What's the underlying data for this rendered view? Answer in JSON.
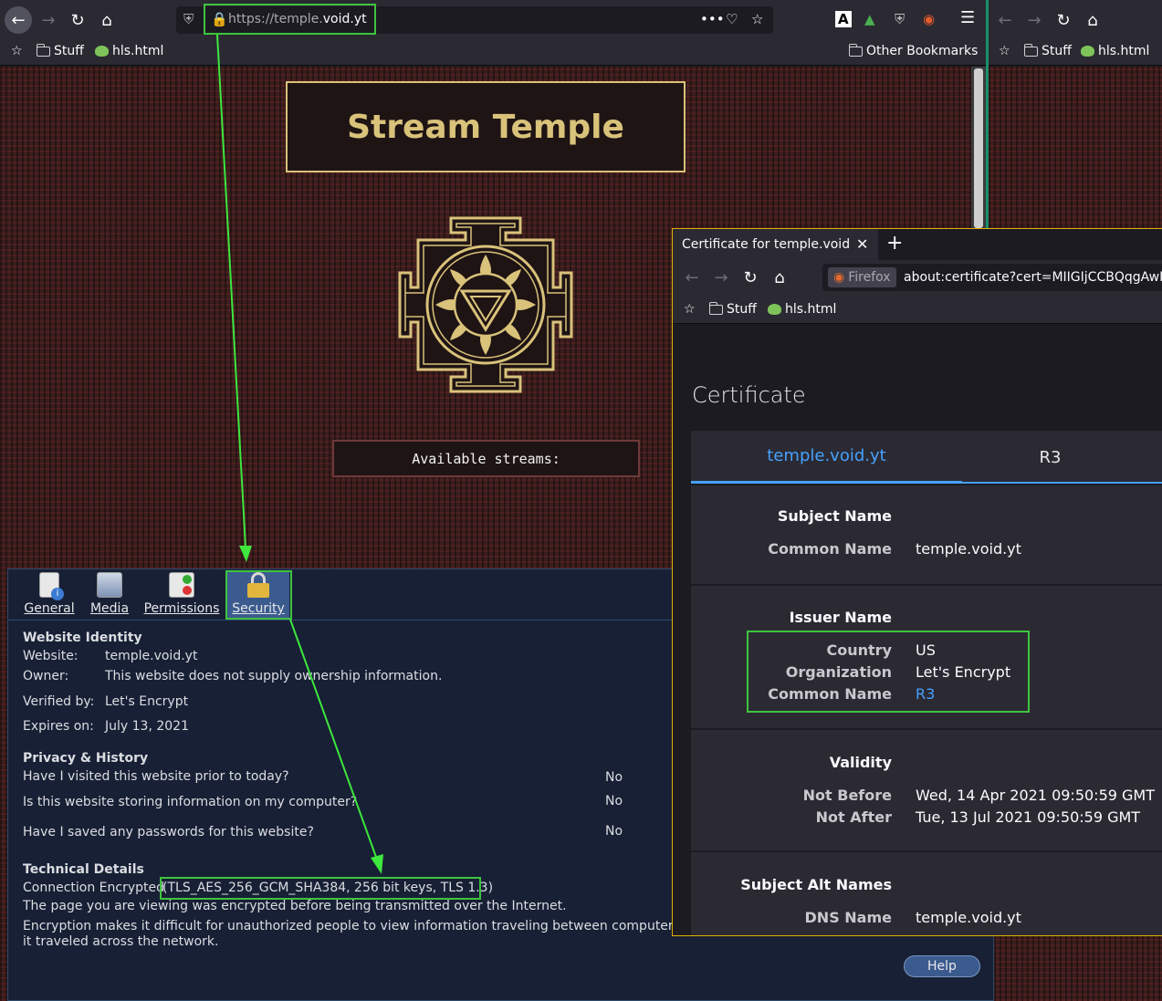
{
  "browser": {
    "url_prefix": "https://temple.",
    "url_domain": "void.yt",
    "bookmarks": {
      "stuff": "Stuff",
      "hls": "hls.html",
      "other": "Other Bookmarks"
    }
  },
  "page": {
    "title": "Stream Temple",
    "streams_label": "Available streams:"
  },
  "page_info": {
    "tabs": {
      "general": "General",
      "media": "Media",
      "permissions": "Permissions",
      "security": "Security"
    },
    "identity": {
      "heading": "Website Identity",
      "website_label": "Website:",
      "website_value": "temple.void.yt",
      "owner_label": "Owner:",
      "owner_value": "This website does not supply ownership information.",
      "verified_label": "Verified by:",
      "verified_value": "Let's Encrypt",
      "expires_label": "Expires on:",
      "expires_value": "July 13, 2021"
    },
    "privacy": {
      "heading": "Privacy & History",
      "q1": "Have I visited this website prior to today?",
      "a1": "No",
      "q2": "Is this website storing information on my computer?",
      "a2": "No",
      "q3": "Have I saved any passwords for this website?",
      "a3": "No"
    },
    "technical": {
      "heading": "Technical Details",
      "encrypted_label": "Connection Encrypted",
      "cipher": "(TLS_AES_256_GCM_SHA384, 256 bit keys, TLS 1.3)",
      "line2": "The page you are viewing was encrypted before being transmitted over the Internet.",
      "line3": "Encryption makes it difficult for unauthorized people to view information traveling between computers. It i",
      "line4": "it traveled across the network."
    },
    "help": "Help"
  },
  "cert_window": {
    "tab_title": "Certificate for temple.void.y",
    "identity_badge": "Firefox",
    "url": "about:certificate?cert=MIIGIjCCBQqgAwI",
    "bookmarks": {
      "stuff": "Stuff",
      "hls": "hls.html"
    },
    "heading": "Certificate",
    "tabs": {
      "leaf": "temple.void.yt",
      "issuer": "R3"
    },
    "subject": {
      "title": "Subject Name",
      "cn_label": "Common Name",
      "cn_value": "temple.void.yt"
    },
    "issuer": {
      "title": "Issuer Name",
      "country_label": "Country",
      "country_value": "US",
      "org_label": "Organization",
      "org_value": "Let's Encrypt",
      "cn_label": "Common Name",
      "cn_value": "R3"
    },
    "validity": {
      "title": "Validity",
      "nb_label": "Not Before",
      "nb_value": "Wed, 14 Apr 2021 09:50:59 GMT",
      "na_label": "Not After",
      "na_value": "Tue, 13 Jul 2021 09:50:59 GMT"
    },
    "san": {
      "title": "Subject Alt Names",
      "dns_label": "DNS Name",
      "dns_value": "temple.void.yt"
    }
  },
  "colors": {
    "accent_blue": "#45a1ff",
    "highlight_green": "#3ec43e",
    "gold": "#d9c27a"
  },
  "icons": [
    "back-icon",
    "forward-icon",
    "reload-icon",
    "home-icon",
    "shield-icon",
    "lock-icon",
    "more-icon",
    "pocket-icon",
    "star-icon",
    "menu-icon"
  ]
}
